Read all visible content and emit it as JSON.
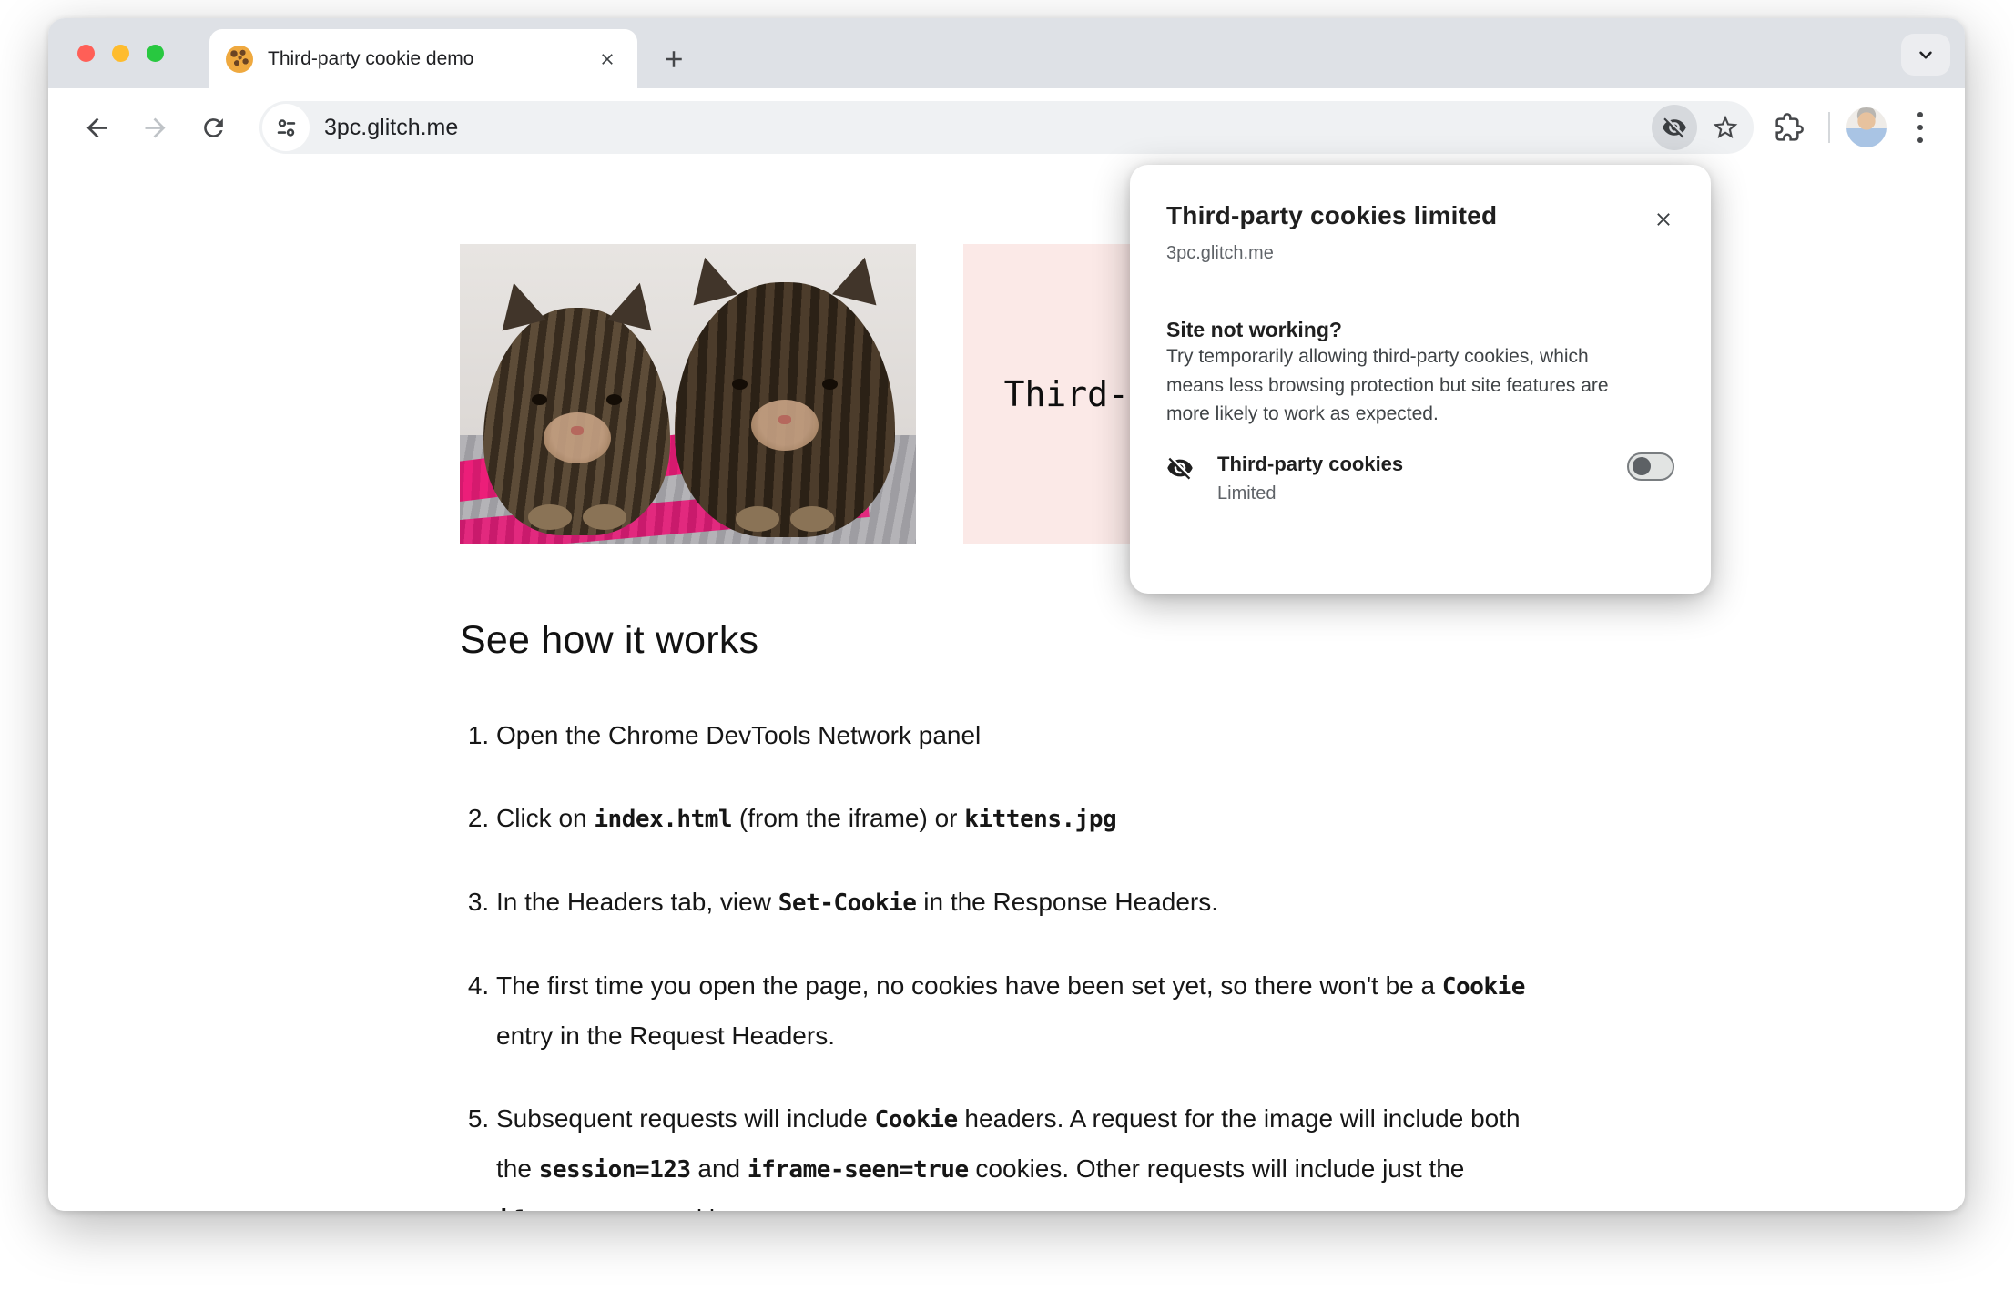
{
  "window": {
    "tab": {
      "title": "Third-party cookie demo"
    },
    "toolbar": {
      "url": "3pc.glitch.me"
    }
  },
  "page": {
    "iframe_label": "Third-party iframe",
    "heading": "See how it works",
    "steps": [
      [
        {
          "t": "Open the Chrome DevTools Network panel"
        }
      ],
      [
        {
          "t": "Click on "
        },
        {
          "t": "index.html",
          "code": true
        },
        {
          "t": " (from the iframe) or "
        },
        {
          "t": "kittens.jpg",
          "code": true
        }
      ],
      [
        {
          "t": "In the Headers tab, view "
        },
        {
          "t": "Set-Cookie",
          "code": true
        },
        {
          "t": " in the Response Headers."
        }
      ],
      [
        {
          "t": "The first time you open the page, no cookies have been set yet, so there won't be a "
        },
        {
          "t": "Cookie",
          "code": true
        },
        {
          "t": " entry in the Request Headers."
        }
      ],
      [
        {
          "t": "Subsequent requests will include "
        },
        {
          "t": "Cookie",
          "code": true
        },
        {
          "t": " headers. A request for the image will include both the "
        },
        {
          "t": "session=123",
          "code": true
        },
        {
          "t": " and "
        },
        {
          "t": "iframe-seen=true",
          "code": true
        },
        {
          "t": " cookies. Other requests will include just the "
        },
        {
          "t": "iframe-seen",
          "code": true
        },
        {
          "t": " cookie."
        }
      ]
    ]
  },
  "popup": {
    "title": "Third-party cookies limited",
    "site": "3pc.glitch.me",
    "section_title": "Site not working?",
    "body_lines": [
      "Try temporarily allowing third-party cookies, which",
      "means less browsing protection but site features are",
      "more likely to work as expected."
    ],
    "toggle_label": "Third-party cookies",
    "toggle_status": "Limited",
    "toggle_state": "off"
  },
  "colors": {
    "tabstrip_bg": "#dee1e6",
    "omnibox_bg": "#eff1f3",
    "iframe_pink": "#fbe9e7",
    "traffic_red": "#ff5f57",
    "traffic_yellow": "#febc2e",
    "traffic_green": "#28c840",
    "text_primary": "#202124",
    "text_secondary": "#5f6368"
  }
}
